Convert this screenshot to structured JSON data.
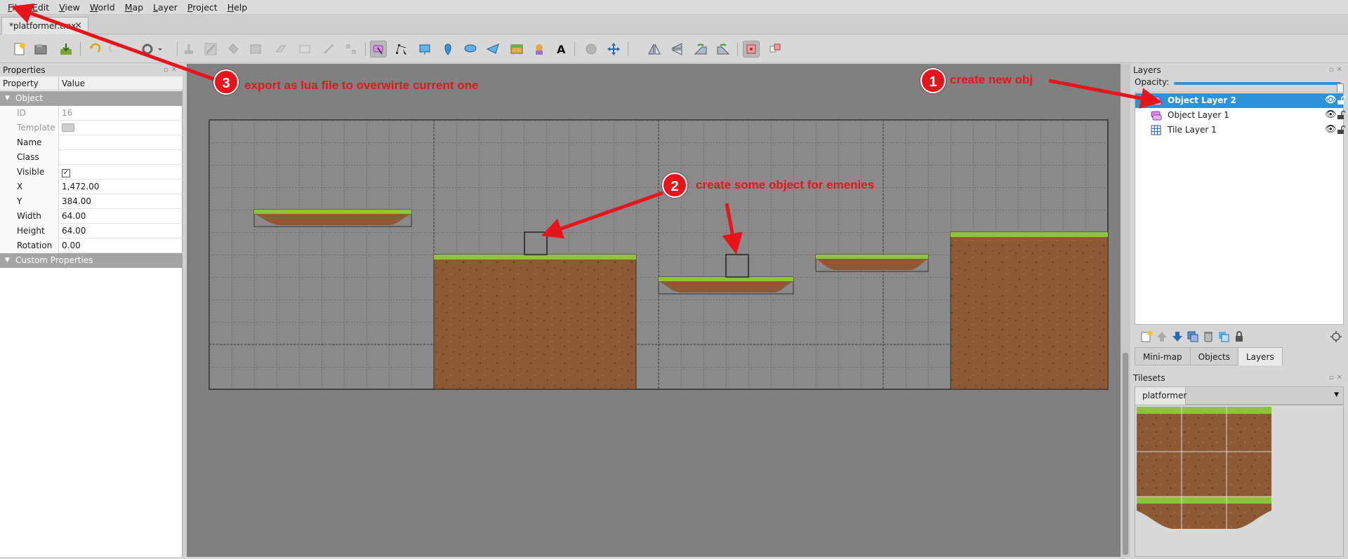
{
  "menu": [
    "File",
    "Edit",
    "View",
    "World",
    "Map",
    "Layer",
    "Project",
    "Help"
  ],
  "document_tab": {
    "label": "*platformer.tmx",
    "close": "×"
  },
  "toolbar": {
    "icons": [
      "new-file-icon",
      "open-file-icon",
      "save-file-icon",
      "undo-icon",
      "redo-icon",
      "commands-icon",
      "stamp-brush-icon",
      "terrain-brush-icon",
      "bucket-fill-icon",
      "shape-fill-icon",
      "eraser-icon",
      "rectangle-select-icon",
      "magic-wand-icon",
      "select-same-tile-icon",
      "select-objects-icon",
      "edit-polygons-icon",
      "insert-rectangle-icon",
      "insert-point-icon",
      "insert-ellipse-icon",
      "insert-polygon-icon",
      "insert-tile-icon",
      "insert-template-icon",
      "insert-text-icon",
      "world-tool-icon",
      "move-icon",
      "flip-horizontal-icon",
      "flip-vertical-icon",
      "rotate-left-icon",
      "rotate-right-icon",
      "random-mode-icon",
      "wang-fill-icon"
    ]
  },
  "properties": {
    "title": "Properties",
    "col_property": "Property",
    "col_value": "Value",
    "group_object": "Object",
    "rows": [
      {
        "key": "ID",
        "value": "16",
        "readonly": true
      },
      {
        "key": "Template",
        "value": "",
        "readonly": true
      },
      {
        "key": "Name",
        "value": ""
      },
      {
        "key": "Class",
        "value": ""
      },
      {
        "key": "Visible",
        "value": "✓"
      },
      {
        "key": "X",
        "value": "1,472.00"
      },
      {
        "key": "Y",
        "value": "384.00"
      },
      {
        "key": "Width",
        "value": "64.00"
      },
      {
        "key": "Height",
        "value": "64.00"
      },
      {
        "key": "Rotation",
        "value": "0.00"
      }
    ],
    "group_custom": "Custom Properties"
  },
  "layers": {
    "title": "Layers",
    "opacity_label": "Opacity:",
    "opacity": 1.0,
    "items": [
      {
        "name": "Object Layer 2",
        "type": "object",
        "selected": true
      },
      {
        "name": "Object Layer 1",
        "type": "object",
        "selected": false
      },
      {
        "name": "Tile Layer 1",
        "type": "tile",
        "selected": false
      }
    ]
  },
  "dock_tabs": [
    "Mini-map",
    "Objects",
    "Layers"
  ],
  "tilesets": {
    "title": "Tilesets",
    "tab": "platformer"
  },
  "annotations": {
    "a1": {
      "num": "1",
      "text": "create new obj"
    },
    "a2": {
      "num": "2",
      "text": "create some object for emenies"
    },
    "a3": {
      "num": "3",
      "text": "export as lua file to overwirte current one"
    }
  },
  "colors": {
    "accent": "#3092d6",
    "annotation": "#e8141c",
    "grass": "#8dc43a",
    "dirt": "#8e5a36",
    "canvas_bg": "#808080"
  }
}
